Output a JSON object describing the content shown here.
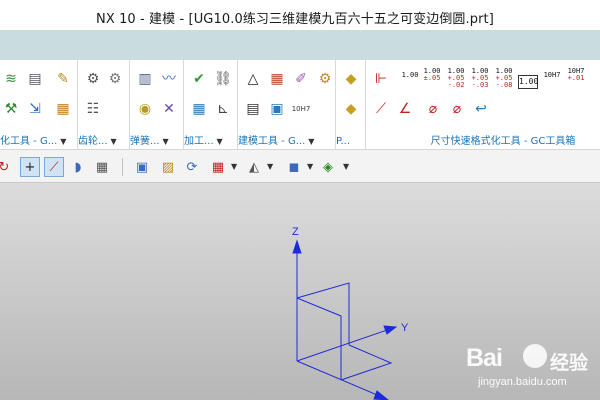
{
  "window": {
    "title": "NX 10 - 建模 - [UG10.0练习三维建模九百六十五之可变边倒圆.prt]"
  },
  "ribbon": {
    "groups": [
      {
        "label": "化工具 - G..."
      },
      {
        "label": "齿轮..."
      },
      {
        "label": "弹簧..."
      },
      {
        "label": "加工..."
      },
      {
        "label": "建模工具 - G..."
      },
      {
        "label": "P..."
      },
      {
        "label": "尺寸快速格式化工具 - GC工具箱"
      }
    ],
    "dimension_buttons": [
      {
        "top": "1.00",
        "bottom": ""
      },
      {
        "top": "1.00",
        "bottom": "±.05"
      },
      {
        "top": "1.00",
        "bottom": "+.05\n-.02"
      },
      {
        "top": "1.00",
        "bottom": "+.05\n-.03"
      },
      {
        "top": "1.00",
        "bottom": "+.05\n-.08"
      },
      {
        "top": "1.00",
        "bottom": ""
      },
      {
        "top": "10H7",
        "bottom": ""
      },
      {
        "top": "10H7",
        "bottom": "+.01"
      }
    ],
    "mid_button_label": "10H7"
  },
  "canvas": {
    "background_top": "#dcdcdc",
    "background_bottom": "#b7b7b7",
    "axis_color": "#1f2bd8",
    "axis_labels": {
      "z": "Z",
      "y": "Y"
    }
  },
  "watermark": {
    "logo": "Bai",
    "cn": "经验",
    "url": "jingyan.baidu.com"
  }
}
